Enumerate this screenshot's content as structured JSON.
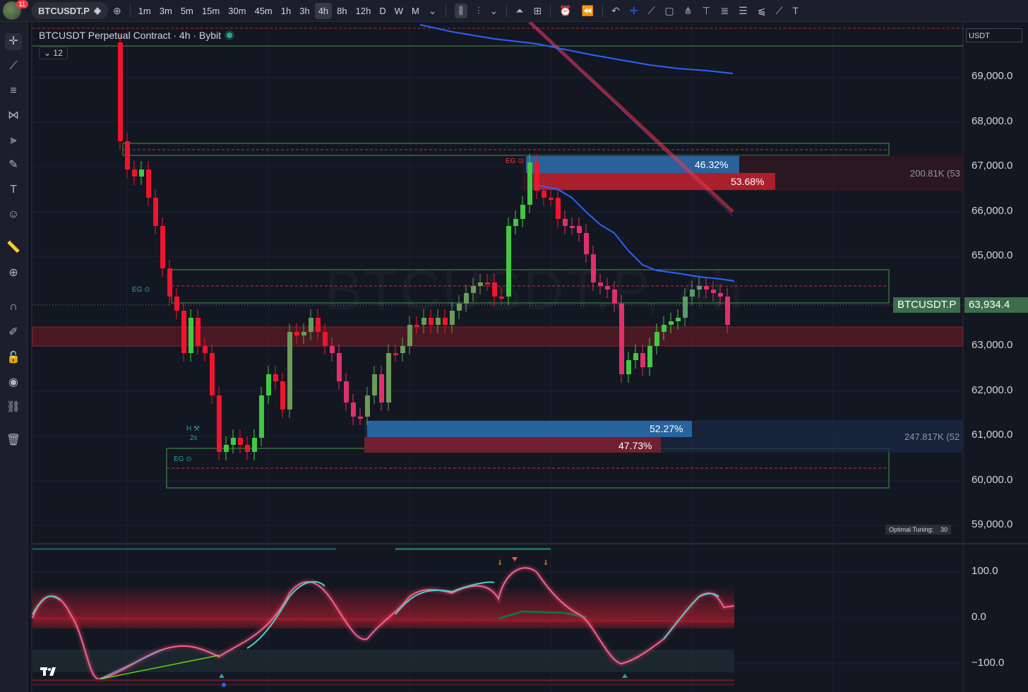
{
  "topbar": {
    "notifications": "11",
    "symbol": "BTCUSDT.P",
    "timeframes": [
      "1m",
      "3m",
      "5m",
      "15m",
      "30m",
      "45m",
      "1h",
      "3h",
      "4h",
      "8h",
      "12h",
      "D",
      "W",
      "M"
    ],
    "active_timeframe": "4h"
  },
  "legend": {
    "title": "BTCUSDT Perpetual Contract · 4h · Bybit",
    "collapsed_count": "12"
  },
  "currency_select": "USDT",
  "watermark": "BTCUSDT.P, 4h",
  "price_axis": [
    "69,000.0",
    "68,000.0",
    "67,000.0",
    "66,000.0",
    "65,000.0",
    "63,000.0",
    "62,000.0",
    "61,000.0",
    "60,000.0",
    "59,000.0"
  ],
  "oscillator_axis": [
    "100.0",
    "0.0",
    "−100.0"
  ],
  "last_price": {
    "symbol_tag": "BTCUSDT.P",
    "value": "63,934.4"
  },
  "zones": {
    "upper_buy_pct": "46.32%",
    "upper_sell_pct": "53.68%",
    "upper_volume": "200.81K (53",
    "lower_buy_pct": "52.27%",
    "lower_sell_pct": "47.73%",
    "lower_volume": "247.817K (52"
  },
  "markers": {
    "eg": "EG ⊙",
    "eg_top": "EG ⊙",
    "eg_low": "EG ⊙",
    "h_label": "H ⚒",
    "h_mult": "2x"
  },
  "tuning": {
    "label": "Optimal Tuning:",
    "value": "30"
  },
  "colors": {
    "background": "#131722",
    "bull": "#43c843",
    "bear": "#f0142e",
    "ma_line": "#2962ff",
    "zone_blue": "#2a6fb0",
    "zone_red": "#b8202e",
    "zone_green_border": "#4caf50"
  },
  "icons": {
    "left_toolbar": [
      "crosshair-icon",
      "trend-line-icon",
      "fib-icon",
      "pattern-icon",
      "prediction-icon",
      "brush-icon",
      "text-icon",
      "emoji-icon",
      "ruler-icon",
      "zoom-icon",
      "magnet-icon",
      "lock-drawing-icon",
      "lock-icon",
      "eye-icon",
      "link-icon",
      "trash-icon"
    ],
    "top_toolbar": [
      "premium-icon",
      "add-symbol-icon",
      "candle-style-icon",
      "bar-style-icon",
      "indicators-icon",
      "templates-icon",
      "alert-icon",
      "replay-icon",
      "undo-icon",
      "cross-icon",
      "line-tool-icon",
      "rect-icon",
      "pitchfork-icon",
      "gann-icon",
      "fib-tool-icon",
      "level-icon",
      "ray-icon",
      "brush-tool-icon",
      "text-tool-icon"
    ]
  }
}
